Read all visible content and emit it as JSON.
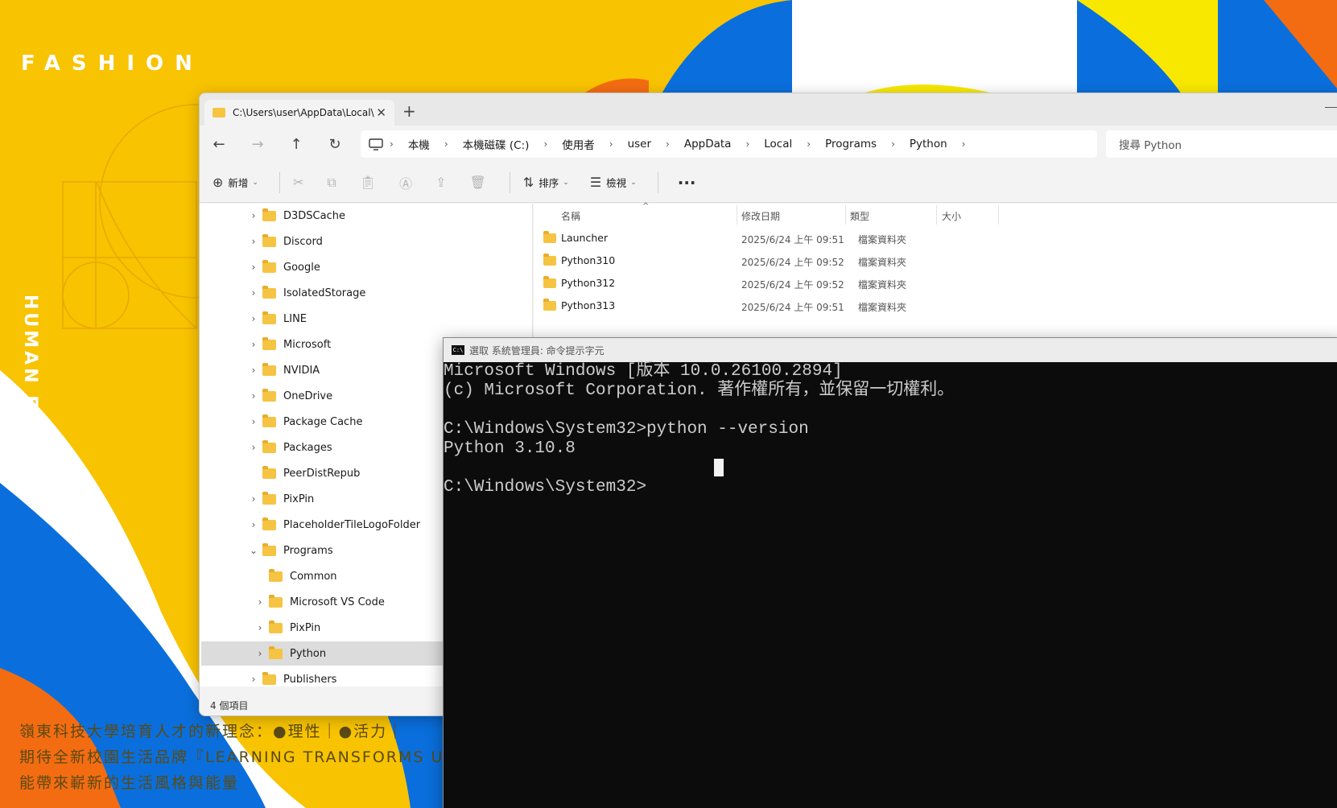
{
  "wallpaper": {
    "heading": "FASHION",
    "vertical_text": "HUMAN ECOLOGY",
    "line1": "嶺東科技大學培育人才的新理念：●理性｜●活力｜",
    "line2": "期待全新校園生活品牌『LEARNING TRANSFORMS U",
    "line3": "能帶來嶄新的生活風格與能量",
    "colors": {
      "yellow": "#f8c300",
      "blue": "#0a6fdc",
      "orange": "#f36c12",
      "white": "#ffffff"
    }
  },
  "explorer": {
    "tab": {
      "title": "C:\\Users\\user\\AppData\\Local\\",
      "close": "✕",
      "new_tab": "+"
    },
    "nav": {
      "back": "←",
      "forward": "→",
      "up": "↑",
      "refresh": "↻"
    },
    "address": {
      "crumbs": [
        "本機",
        "本機磁碟 (C:)",
        "使用者",
        "user",
        "AppData",
        "Local",
        "Programs",
        "Python"
      ],
      "separator": "›"
    },
    "search": {
      "placeholder": "搜尋 Python"
    },
    "commands": {
      "new_label": "新增",
      "sort_label": "排序",
      "view_label": "檢視",
      "more": "···",
      "icons": [
        "cut-icon",
        "copy-icon",
        "paste-icon",
        "rename-icon",
        "share-icon",
        "delete-icon"
      ]
    },
    "tree": [
      {
        "label": "D3DSCache",
        "expandable": true,
        "indent": 0
      },
      {
        "label": "Discord",
        "expandable": true,
        "indent": 0
      },
      {
        "label": "Google",
        "expandable": true,
        "indent": 0
      },
      {
        "label": "IsolatedStorage",
        "expandable": true,
        "indent": 0
      },
      {
        "label": "LINE",
        "expandable": true,
        "indent": 0
      },
      {
        "label": "Microsoft",
        "expandable": true,
        "indent": 0
      },
      {
        "label": "NVIDIA",
        "expandable": true,
        "indent": 0
      },
      {
        "label": "OneDrive",
        "expandable": true,
        "indent": 0
      },
      {
        "label": "Package Cache",
        "expandable": true,
        "indent": 0
      },
      {
        "label": "Packages",
        "expandable": true,
        "indent": 0
      },
      {
        "label": "PeerDistRepub",
        "expandable": false,
        "indent": 0
      },
      {
        "label": "PixPin",
        "expandable": true,
        "indent": 0
      },
      {
        "label": "PlaceholderTileLogoFolder",
        "expandable": true,
        "indent": 0
      },
      {
        "label": "Programs",
        "expandable": true,
        "expanded": true,
        "indent": 0
      },
      {
        "label": "Common",
        "expandable": false,
        "indent": 1
      },
      {
        "label": "Microsoft VS Code",
        "expandable": true,
        "indent": 1
      },
      {
        "label": "PixPin",
        "expandable": true,
        "indent": 1
      },
      {
        "label": "Python",
        "expandable": true,
        "indent": 1,
        "selected": true
      },
      {
        "label": "Publishers",
        "expandable": true,
        "indent": 0
      }
    ],
    "columns": {
      "name": "名稱",
      "date": "修改日期",
      "type": "類型",
      "size": "大小"
    },
    "files": [
      {
        "name": "Launcher",
        "date": "2025/6/24 上午 09:51",
        "type": "檔案資料夾"
      },
      {
        "name": "Python310",
        "date": "2025/6/24 上午 09:52",
        "type": "檔案資料夾"
      },
      {
        "name": "Python312",
        "date": "2025/6/24 上午 09:52",
        "type": "檔案資料夾"
      },
      {
        "name": "Python313",
        "date": "2025/6/24 上午 09:51",
        "type": "檔案資料夾"
      }
    ],
    "status": "4 個項目"
  },
  "cmd": {
    "title": "選取 系統管理員: 命令提示字元",
    "icon_text": "C:\\",
    "lines": [
      "Microsoft Windows [版本 10.0.26100.2894]",
      "(c) Microsoft Corporation. 著作權所有，並保留一切權利。",
      "",
      "C:\\Windows\\System32>python --version",
      "Python 3.10.8",
      "",
      "C:\\Windows\\System32>"
    ]
  }
}
